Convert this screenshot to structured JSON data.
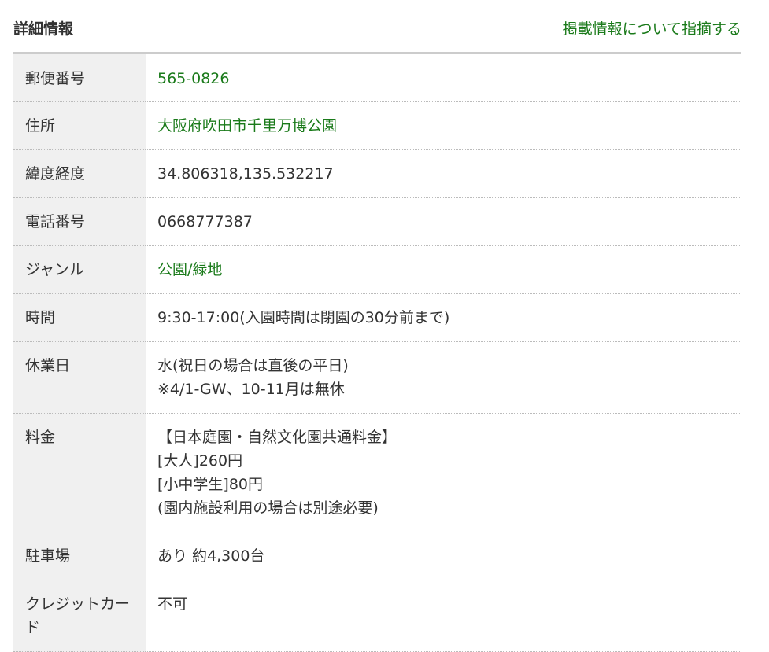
{
  "header": {
    "title": "詳細情報",
    "report_link": "掲載情報について指摘する"
  },
  "colors": {
    "link_green": "#1a7a1a",
    "label_bg": "#f0f0f0",
    "text": "#333333"
  },
  "rows": {
    "postal": {
      "label": "郵便番号",
      "value": "565-0826"
    },
    "address": {
      "label": "住所",
      "value": "大阪府吹田市千里万博公園"
    },
    "latlng": {
      "label": "緯度経度",
      "value": "34.806318,135.532217"
    },
    "phone": {
      "label": "電話番号",
      "value": "0668777387"
    },
    "genre": {
      "label": "ジャンル",
      "value": "公園/緑地"
    },
    "hours": {
      "label": "時間",
      "value": "9:30-17:00(入園時間は閉園の30分前まで)"
    },
    "closed": {
      "label": "休業日",
      "lines": [
        "水(祝日の場合は直後の平日)",
        "※4/1-GW、10-11月は無休"
      ]
    },
    "fee": {
      "label": "料金",
      "lines": [
        "【日本庭園・自然文化園共通料金】",
        "[大人]260円",
        "[小中学生]80円",
        "(園内施設利用の場合は別途必要)"
      ]
    },
    "parking": {
      "label": "駐車場",
      "value": "あり 約4,300台"
    },
    "credit": {
      "label": "クレジットカード",
      "value": "不可"
    }
  }
}
